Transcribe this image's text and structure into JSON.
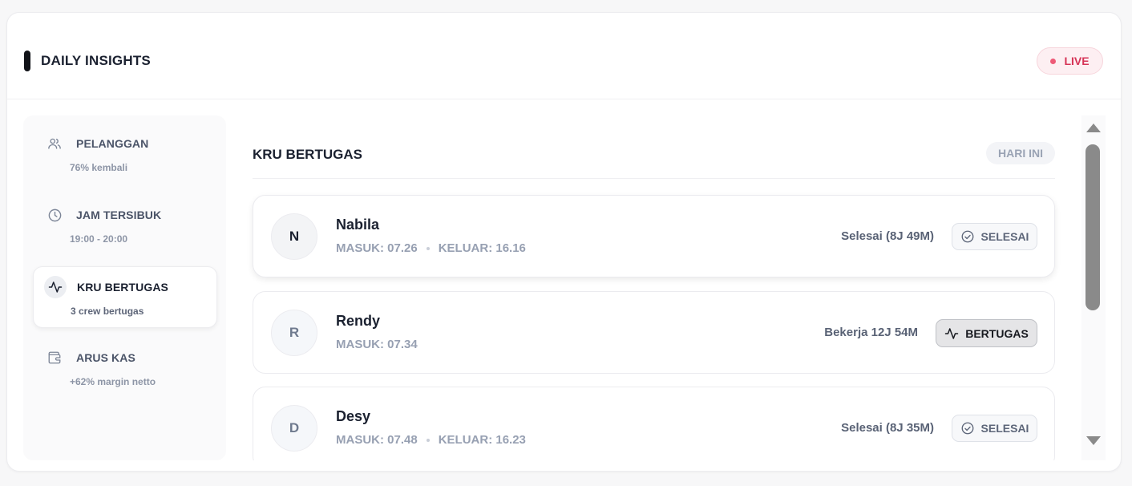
{
  "header": {
    "title": "DAILY INSIGHTS",
    "live_label": "LIVE"
  },
  "sidebar": {
    "items": [
      {
        "label": "PELANGGAN",
        "sub": "76% kembali",
        "icon": "users-icon",
        "active": false
      },
      {
        "label": "JAM TERSIBUK",
        "sub": "19:00 - 20:00",
        "icon": "clock-icon",
        "active": false
      },
      {
        "label": "KRU BERTUGAS",
        "sub": "3 crew bertugas",
        "icon": "activity-icon",
        "active": true
      },
      {
        "label": "ARUS KAS",
        "sub": "+62% margin netto",
        "icon": "wallet-icon",
        "active": false
      }
    ]
  },
  "main": {
    "title": "KRU BERTUGAS",
    "period_badge": "HARI INI",
    "crew": [
      {
        "initial": "N",
        "name": "Nabila",
        "masuk": "MASUK: 07.26",
        "keluar": "KELUAR: 16.16",
        "status_text": "Selesai (8J 49M)",
        "button_label": "SELESAI",
        "button_icon": "check-circle-icon"
      },
      {
        "initial": "R",
        "name": "Rendy",
        "masuk": "MASUK: 07.34",
        "keluar": "",
        "status_text": "Bekerja 12J 54M",
        "button_label": "BERTUGAS",
        "button_icon": "activity-icon"
      },
      {
        "initial": "D",
        "name": "Desy",
        "masuk": "MASUK: 07.48",
        "keluar": "KELUAR: 16.23",
        "status_text": "Selesai (8J 35M)",
        "button_label": "SELESAI",
        "button_icon": "check-circle-icon"
      }
    ]
  },
  "colors": {
    "live": "#d63356",
    "accent_dark": "#111318",
    "muted_text": "#97a0b2"
  }
}
